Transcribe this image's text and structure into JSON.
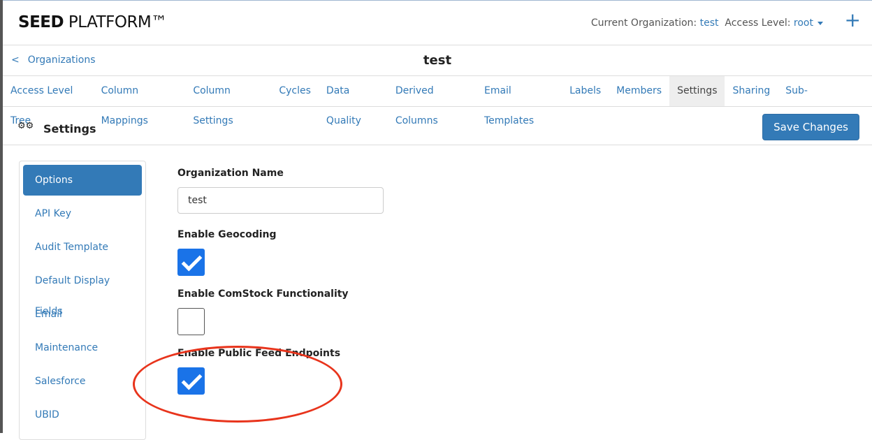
{
  "header": {
    "brand_bold": "SEED",
    "brand_rest": " PLATFORM™",
    "current_org_label": "Current Organization:",
    "current_org": "test",
    "access_level_label": "Access Level:",
    "access_level": "root",
    "plus": "+"
  },
  "breadcrumb": {
    "back": "Organizations",
    "title": "test"
  },
  "tabs": [
    "Access Level Tree",
    "Column Mappings",
    "Column Settings",
    "Cycles",
    "Data Quality",
    "Derived Columns",
    "Email Templates",
    "Labels",
    "Members",
    "Settings",
    "Sharing",
    "Sub-Organizations"
  ],
  "active_tab": "Settings",
  "section": {
    "title": "Settings",
    "save": "Save Changes"
  },
  "sidebar": [
    "Options",
    "API Key",
    "Audit Template",
    "Default Display Fields",
    "Email",
    "Maintenance",
    "Salesforce",
    "UBID"
  ],
  "form": {
    "org_name_label": "Organization Name",
    "org_name_value": "test",
    "geocoding_label": "Enable Geocoding",
    "geocoding": true,
    "comstock_label": "Enable ComStock Functionality",
    "comstock": false,
    "public_feed_label": "Enable Public Feed Endpoints",
    "public_feed": true
  },
  "colors": {
    "accent": "#337ab7",
    "checkbox": "#1a73e8",
    "annotation": "#e8341c"
  }
}
